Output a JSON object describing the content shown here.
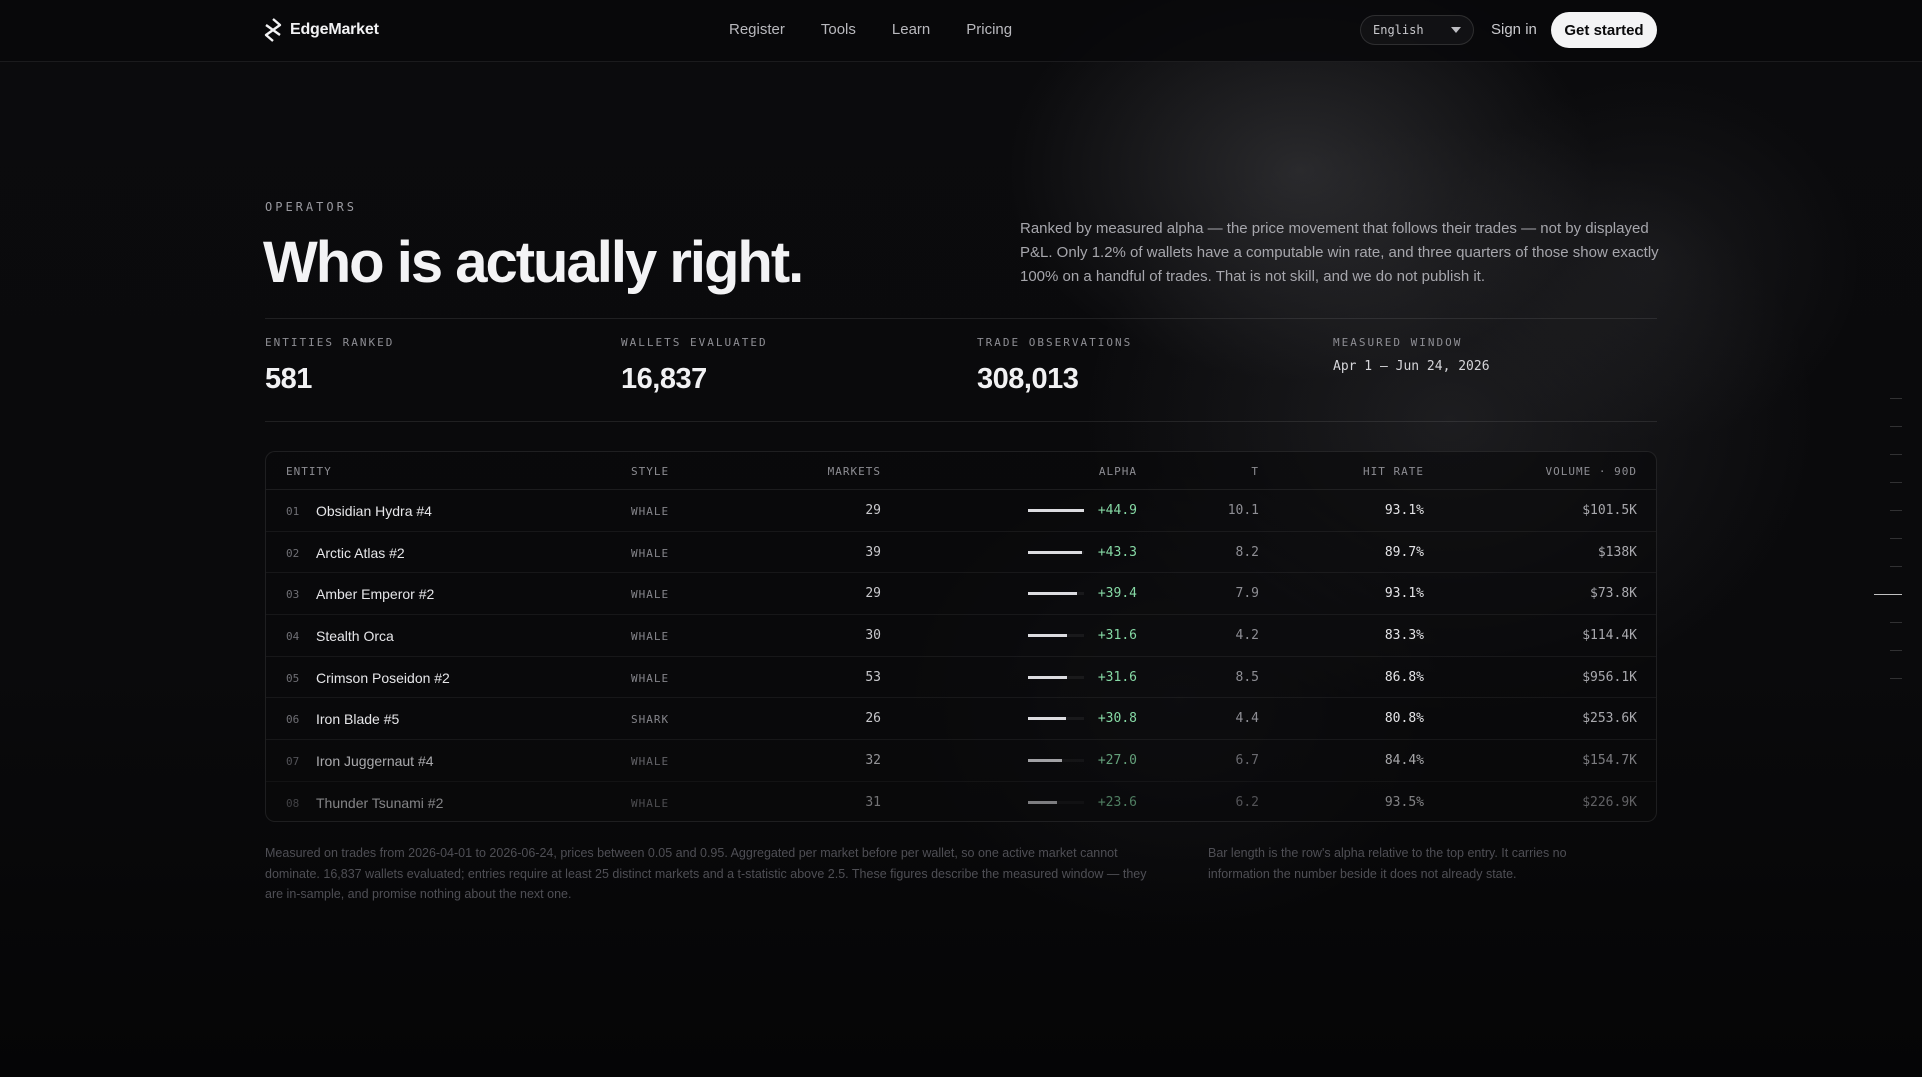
{
  "brand": {
    "name": "EdgeMarket"
  },
  "nav": {
    "links": [
      "Register",
      "Tools",
      "Learn",
      "Pricing"
    ],
    "language": "English",
    "sign_in": "Sign in",
    "cta": "Get started"
  },
  "hero": {
    "eyebrow": "OPERATORS",
    "title": "Who is actually right.",
    "lede": "Ranked by measured alpha — the price movement that follows their trades — not by displayed P&L. Only 1.2% of wallets have a computable win rate, and three quarters of those show exactly 100% on a handful of trades. That is not skill, and we do not publish it."
  },
  "stats": [
    {
      "label": "ENTITIES RANKED",
      "value": "581"
    },
    {
      "label": "WALLETS EVALUATED",
      "value": "16,837"
    },
    {
      "label": "TRADE OBSERVATIONS",
      "value": "308,013"
    },
    {
      "label": "MEASURED WINDOW",
      "value": "Apr 1 — Jun 24, 2026"
    }
  ],
  "table": {
    "columns": [
      "ENTITY",
      "STYLE",
      "MARKETS",
      "ALPHA",
      "T",
      "HIT RATE",
      "VOLUME · 90D"
    ],
    "rows": [
      {
        "rank": "01",
        "name": "Obsidian Hydra #4",
        "style": "WHALE",
        "markets": "29",
        "alpha": "+44.9",
        "alpha_value": 44.9,
        "t": "10.1",
        "hit": "93.1%",
        "volume": "$101.5K"
      },
      {
        "rank": "02",
        "name": "Arctic Atlas #2",
        "style": "WHALE",
        "markets": "39",
        "alpha": "+43.3",
        "alpha_value": 43.3,
        "t": "8.2",
        "hit": "89.7%",
        "volume": "$138K"
      },
      {
        "rank": "03",
        "name": "Amber Emperor #2",
        "style": "WHALE",
        "markets": "29",
        "alpha": "+39.4",
        "alpha_value": 39.4,
        "t": "7.9",
        "hit": "93.1%",
        "volume": "$73.8K"
      },
      {
        "rank": "04",
        "name": "Stealth Orca",
        "style": "WHALE",
        "markets": "30",
        "alpha": "+31.6",
        "alpha_value": 31.6,
        "t": "4.2",
        "hit": "83.3%",
        "volume": "$114.4K"
      },
      {
        "rank": "05",
        "name": "Crimson Poseidon #2",
        "style": "WHALE",
        "markets": "53",
        "alpha": "+31.6",
        "alpha_value": 31.6,
        "t": "8.5",
        "hit": "86.8%",
        "volume": "$956.1K"
      },
      {
        "rank": "06",
        "name": "Iron Blade #5",
        "style": "SHARK",
        "markets": "26",
        "alpha": "+30.8",
        "alpha_value": 30.8,
        "t": "4.4",
        "hit": "80.8%",
        "volume": "$253.6K"
      },
      {
        "rank": "07",
        "name": "Iron Juggernaut #4",
        "style": "WHALE",
        "markets": "32",
        "alpha": "+27.0",
        "alpha_value": 27.0,
        "t": "6.7",
        "hit": "84.4%",
        "volume": "$154.7K"
      },
      {
        "rank": "08",
        "name": "Thunder Tsunami #2",
        "style": "WHALE",
        "markets": "31",
        "alpha": "+23.6",
        "alpha_value": 23.6,
        "t": "6.2",
        "hit": "93.5%",
        "volume": "$226.9K"
      }
    ]
  },
  "notes": {
    "method": "Measured on trades from 2026-04-01 to 2026-06-24, prices between 0.05 and 0.95. Aggregated per market before per wallet, so one active market cannot dominate. 16,837 wallets evaluated; entries require at least 25 distinct markets and a t-statistic above 2.5. These figures describe the measured window — they are in-sample, and promise nothing about the next one.",
    "bars": "Bar length is the row's alpha relative to the top entry. It carries no information the number beside it does not already state."
  },
  "colors": {
    "alpha_positive": "#86d9a5",
    "cta_bg": "#f4f4f5",
    "background": "#08080a"
  },
  "scroll_indicator": {
    "count": 11,
    "active_index": 7
  }
}
